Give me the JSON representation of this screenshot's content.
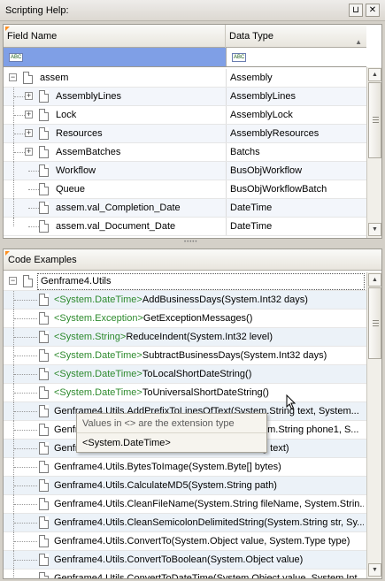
{
  "window": {
    "title": "Scripting Help:",
    "pin_glyph": "⊔",
    "close_glyph": "✕"
  },
  "help_grid": {
    "columns": {
      "field_name": "Field Name",
      "data_type": "Data Type"
    },
    "filter_icon": "abc-filter-icon",
    "filter_glyph": "ABC",
    "rows": [
      {
        "name": "assem",
        "type": "Assembly",
        "expander": "−"
      },
      {
        "name": "AssemblyLines",
        "type": "AssemblyLines",
        "expander": "+"
      },
      {
        "name": "Lock",
        "type": "AssemblyLock",
        "expander": "+"
      },
      {
        "name": "Resources",
        "type": "AssemblyResources",
        "expander": "+"
      },
      {
        "name": "AssemBatches",
        "type": "Batchs",
        "expander": "+"
      },
      {
        "name": "Workflow",
        "type": "BusObjWorkflow",
        "expander": ""
      },
      {
        "name": "Queue",
        "type": "BusObjWorkflowBatch",
        "expander": ""
      },
      {
        "name": "assem.val_Completion_Date",
        "type": "DateTime",
        "expander": ""
      },
      {
        "name": "assem.val_Document_Date",
        "type": "DateTime",
        "expander": ""
      }
    ]
  },
  "code_examples": {
    "title": "Code Examples",
    "root": "Genframe4.Utils",
    "root_expander": "−",
    "rows": [
      {
        "ext": "<System.DateTime>",
        "text": "AddBusinessDays(System.Int32 days)"
      },
      {
        "ext": "<System.Exception>",
        "text": "GetExceptionMessages()"
      },
      {
        "ext": "<System.String>",
        "text": "ReduceIndent(System.Int32 level)"
      },
      {
        "ext": "<System.DateTime>",
        "text": "SubtractBusinessDays(System.Int32 days)"
      },
      {
        "ext": "<System.DateTime>",
        "text": "ToLocalShortDateString()"
      },
      {
        "ext": "<System.DateTime>",
        "text": "ToUniversalShortDateString()"
      },
      {
        "ext": "",
        "text": "Genframe4.Utils.AddPrefixToLinesOfText(System.String text, System..."
      },
      {
        "ext": "",
        "text": "Genfr"
      },
      {
        "ext": "",
        "text": "Genfr"
      },
      {
        "ext": "",
        "text": "Genframe4.Utils.BytesToImage(System.Byte[] bytes)"
      },
      {
        "ext": "",
        "text": "Genframe4.Utils.CalculateMD5(System.String path)"
      },
      {
        "ext": "",
        "text": "Genframe4.Utils.CleanFileName(System.String fileName, System.Strin..."
      },
      {
        "ext": "",
        "text": "Genframe4.Utils.CleanSemicolonDelimitedString(System.String str, Sy..."
      },
      {
        "ext": "",
        "text": "Genframe4.Utils.ConvertTo(System.Object value, System.Type type)"
      },
      {
        "ext": "",
        "text": "Genframe4.Utils.ConvertToBoolean(System.Object value)"
      },
      {
        "ext": "",
        "text": "Genframe4.Utils.ConvertToDateTime(System.Object value, System.Int..."
      }
    ],
    "partial_row8_tail": "em.String phone1, S...",
    "partial_row9_tail": "g text)"
  },
  "tooltip": {
    "title": "Values in <> are the extension type",
    "body": "<System.DateTime>"
  },
  "colors": {
    "selected_filter": "#7f9fe6",
    "extension_green": "#2d8a2d",
    "header_orange": "#ff8f20"
  }
}
